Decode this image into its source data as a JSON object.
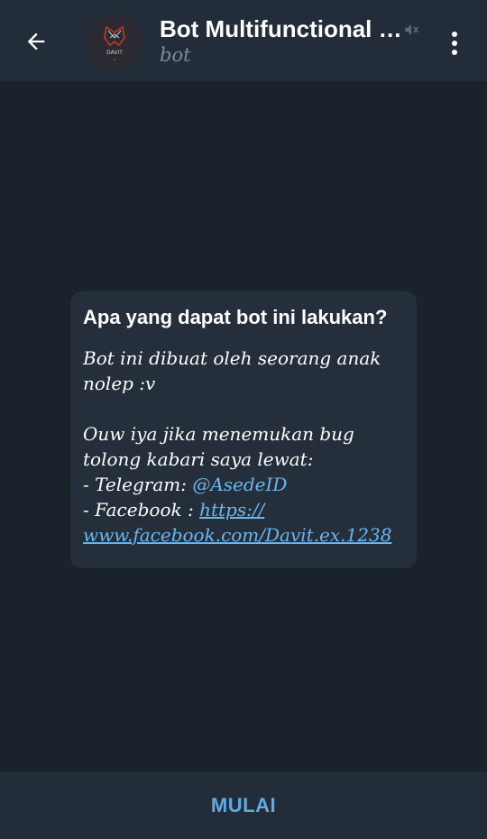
{
  "header": {
    "title": "Bot Multifunctional [...",
    "subtitle": "bot",
    "avatar_text": "DAVIT"
  },
  "message": {
    "heading": "Apa yang dapat bot ini lakukan?",
    "para1": "Bot ini dibuat oleh seorang anak nolep :v",
    "para2": "Ouw iya jika menemukan bug tolong kabari saya lewat:",
    "telegram_label": "- Telegram: ",
    "telegram_handle": "@AsedeID",
    "facebook_label": "- Facebook : ",
    "facebook_link_1": "https://",
    "facebook_link_2": "www.facebook.com/Davit.ex.1238"
  },
  "bottom": {
    "start_label": "MULAI"
  },
  "colors": {
    "background": "#1a222c",
    "header": "#222d39",
    "bubble": "#242f3b",
    "link": "#6bb6f0",
    "accent": "#62a9e4"
  }
}
